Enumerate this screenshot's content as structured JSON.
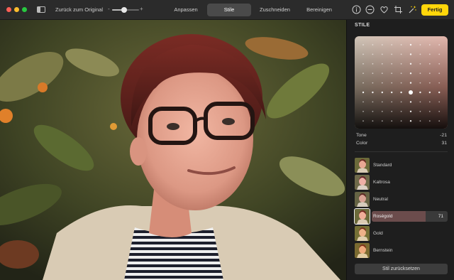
{
  "window": {
    "controls": [
      "close",
      "minimize",
      "zoom"
    ]
  },
  "toolbar": {
    "revert_label": "Zurück zum Original",
    "zoom": {
      "minus": "-",
      "plus": "+",
      "level": 0.45
    },
    "tabs": [
      {
        "label": "Anpassen",
        "active": false
      },
      {
        "label": "Stile",
        "active": true
      },
      {
        "label": "Zuschneiden",
        "active": false
      },
      {
        "label": "Bereinigen",
        "active": false
      }
    ],
    "icons": [
      "info-icon",
      "minus-circle-icon",
      "heart-icon",
      "crop-rotate-icon",
      "magic-wand-icon"
    ],
    "done_label": "Fertig",
    "accent": "#ffd60a"
  },
  "panel": {
    "title": "STILE",
    "tone": {
      "label": "Tone",
      "value": "-21"
    },
    "color": {
      "label": "Color",
      "value": "31"
    },
    "presets": [
      {
        "label": "Standard",
        "selected": false
      },
      {
        "label": "Kaltrosa",
        "selected": false
      },
      {
        "label": "Neutral",
        "selected": false
      },
      {
        "label": "Roségold",
        "selected": true,
        "value": "71",
        "level": 0.71
      },
      {
        "label": "Gold",
        "selected": false
      },
      {
        "label": "Bernstein",
        "selected": false
      }
    ],
    "reset_label": "Stil zurücksetzen"
  }
}
